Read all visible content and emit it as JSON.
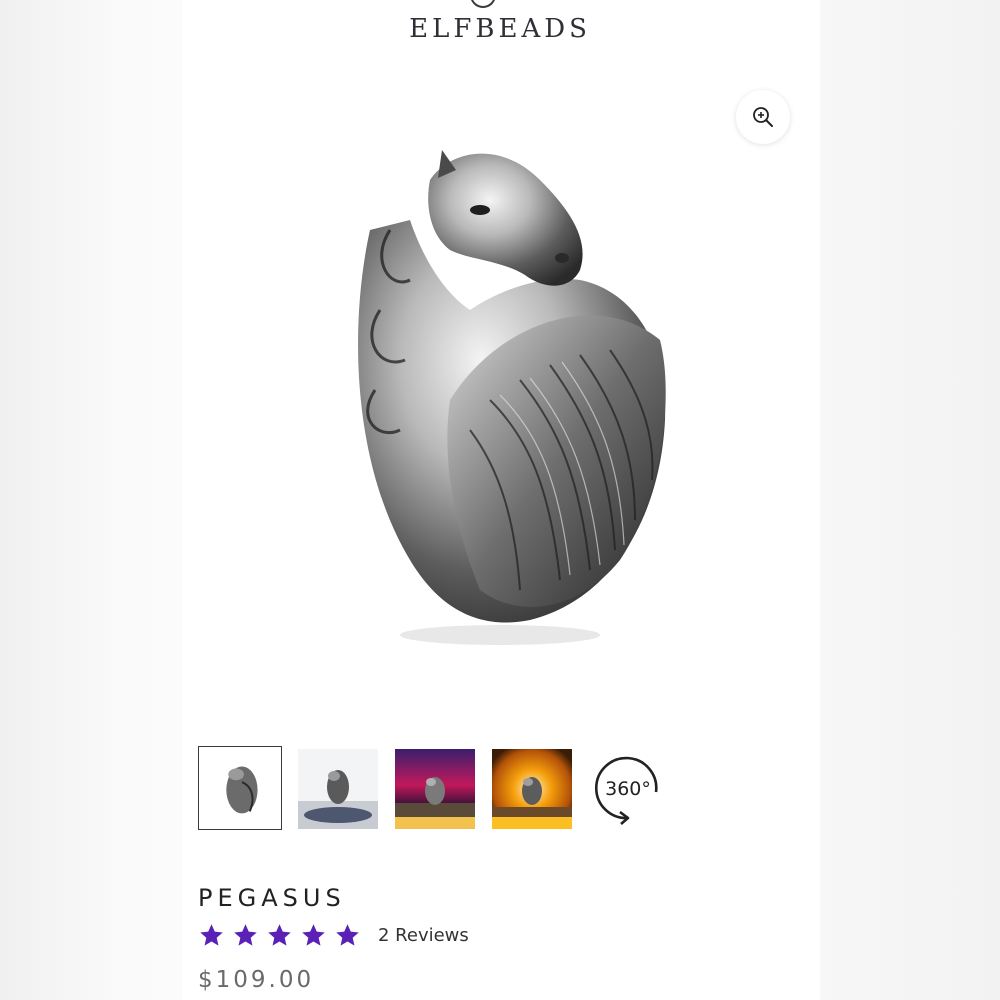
{
  "brand": {
    "logo_text": "ELFBEADS"
  },
  "zoom": {
    "icon": "zoom-in-icon"
  },
  "gallery": {
    "thumbnails": [
      {
        "name": "thumb-1",
        "active": true
      },
      {
        "name": "thumb-2",
        "active": false
      },
      {
        "name": "thumb-3",
        "active": false
      },
      {
        "name": "thumb-4",
        "active": false
      }
    ],
    "rotate_label": "360°"
  },
  "product": {
    "title": "PEGASUS",
    "rating": 5,
    "reviews_label": "2 Reviews",
    "price": "$109.00"
  },
  "colors": {
    "star": "#5b21b6",
    "title": "#222222",
    "price": "#6a6a6a"
  }
}
